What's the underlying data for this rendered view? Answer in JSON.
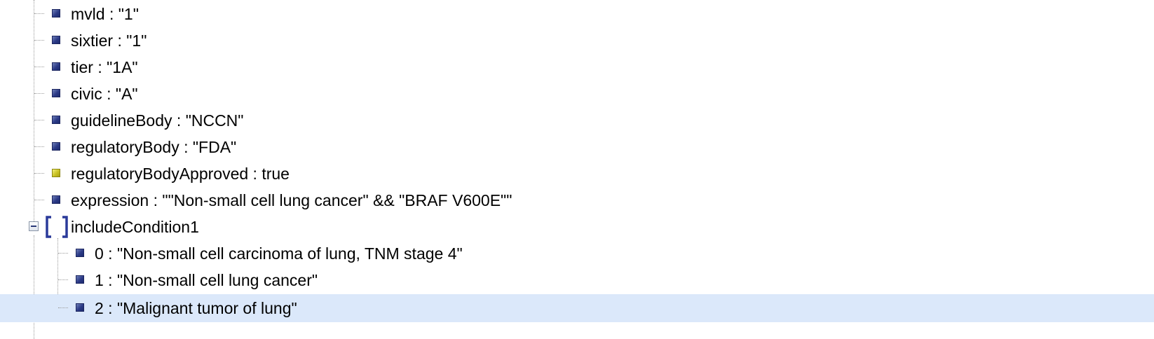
{
  "tree": {
    "items": [
      {
        "key": "mvld",
        "sep": " : ",
        "value": "\"1\"",
        "type": "string"
      },
      {
        "key": "sixtier",
        "sep": " : ",
        "value": "\"1\"",
        "type": "string"
      },
      {
        "key": "tier",
        "sep": " : ",
        "value": "\"1A\"",
        "type": "string"
      },
      {
        "key": "civic",
        "sep": " : ",
        "value": "\"A\"",
        "type": "string"
      },
      {
        "key": "guidelineBody",
        "sep": " : ",
        "value": "\"NCCN\"",
        "type": "string"
      },
      {
        "key": "regulatoryBody",
        "sep": " : ",
        "value": "\"FDA\"",
        "type": "string"
      },
      {
        "key": "regulatoryBodyApproved",
        "sep": " : ",
        "value": "true",
        "type": "boolean"
      },
      {
        "key": "expression",
        "sep": " : ",
        "value": "\"\"Non-small cell lung cancer\" && \"BRAF V600E\"\"",
        "type": "string"
      }
    ],
    "array_node": {
      "key": "includeCondition1",
      "expanded": true,
      "children": [
        {
          "key": "0",
          "sep": " : ",
          "value": "\"Non-small cell carcinoma of lung, TNM stage 4\"",
          "type": "string"
        },
        {
          "key": "1",
          "sep": " : ",
          "value": "\"Non-small cell lung cancer\"",
          "type": "string"
        },
        {
          "key": "2",
          "sep": " : ",
          "value": "\"Malignant tumor of lung\"",
          "type": "string",
          "selected": true
        }
      ]
    }
  },
  "colors": {
    "selection": "#dbe8fa",
    "string_icon": "#2b3a86",
    "boolean_icon": "#c9c224",
    "bracket_icon": "#2a3a9a",
    "guide_line": "#9a9a9a"
  }
}
